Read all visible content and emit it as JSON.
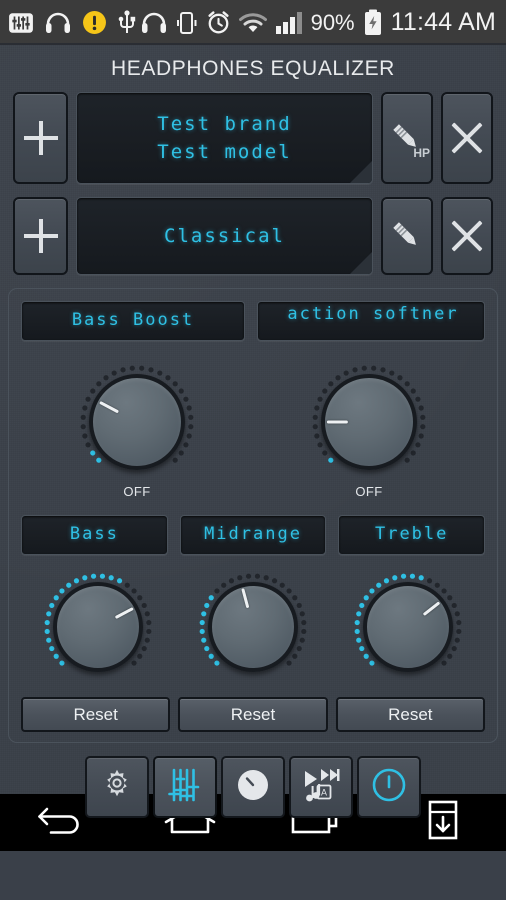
{
  "status_bar": {
    "icons": [
      "equalizer-icon",
      "headphones-icon",
      "warning-icon",
      "usb-icon",
      "headset-icon",
      "vibrate-icon",
      "alarm-icon",
      "wifi-icon",
      "signal-icon"
    ],
    "battery_percent": "90%",
    "battery_icon": "battery-charging-icon",
    "clock": "11:44 AM"
  },
  "app": {
    "title": "HEADPHONES EQUALIZER",
    "accent_color": "#2fc0e4",
    "background_color": "#3a4049",
    "lcd_background_color": "#191d22"
  },
  "device_row": {
    "add_label": "+",
    "display_line1": "Test brand",
    "display_line2": "Test model",
    "edit_icon": "pencil-icon",
    "edit_badge": "HP",
    "close_label": "✕"
  },
  "preset_row": {
    "add_label": "+",
    "display_text": "Classical",
    "edit_icon": "pencil-icon",
    "close_label": "✕"
  },
  "effects": {
    "bass_boost": {
      "label": "Bass Boost",
      "knob_value_label": "OFF",
      "knob_angle": -152,
      "lit_fraction": 0.06
    },
    "reaction_softner": {
      "label": "action softner",
      "knob_value_label": "OFF",
      "knob_angle": -180,
      "lit_fraction": 0.02
    }
  },
  "bands": [
    {
      "label": "Bass",
      "knob_angle": -28,
      "lit_fraction": 0.62,
      "reset_label": "Reset"
    },
    {
      "label": "Midrange",
      "knob_angle": -105,
      "lit_fraction": 0.33,
      "reset_label": "Reset"
    },
    {
      "label": "Treble",
      "knob_angle": -38,
      "lit_fraction": 0.58,
      "reset_label": "Reset"
    }
  ],
  "toolbar": {
    "buttons": [
      {
        "name": "settings",
        "icon": "gear-icon",
        "active": false
      },
      {
        "name": "equalizer",
        "icon": "sliders-icon",
        "active": true
      },
      {
        "name": "knob",
        "icon": "knob-icon",
        "active": false
      },
      {
        "name": "player",
        "icon": "play-skip-music-icon",
        "active": false
      },
      {
        "name": "power",
        "icon": "power-icon",
        "active": false
      }
    ]
  },
  "nav_bar": {
    "buttons": [
      {
        "name": "back",
        "icon": "back-arrow-icon"
      },
      {
        "name": "home",
        "icon": "home-icon"
      },
      {
        "name": "recents",
        "icon": "recents-icon"
      },
      {
        "name": "capture",
        "icon": "capture-down-icon"
      }
    ]
  }
}
